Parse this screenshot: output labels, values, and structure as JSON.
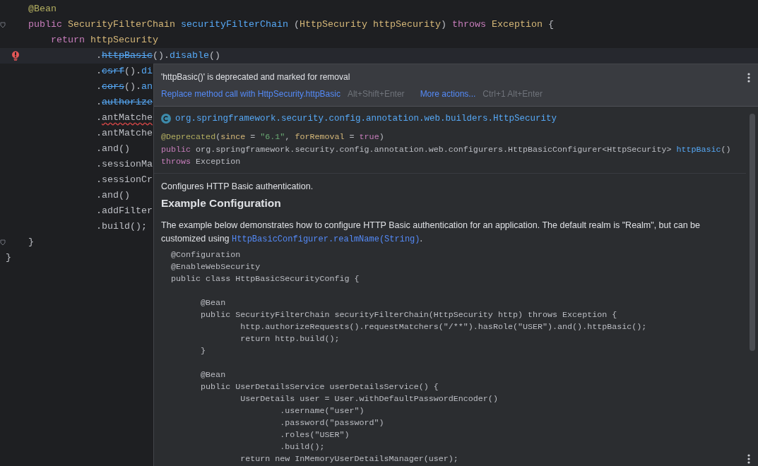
{
  "editor": {
    "lines": [
      {
        "current": false,
        "tokens": [
          {
            "text": "    @Bean",
            "kind": "annotation"
          }
        ]
      },
      {
        "current": false,
        "fold": true,
        "tokens": [
          {
            "text": "    public ",
            "kind": "keyword"
          },
          {
            "text": "SecurityFilterChain ",
            "kind": "type"
          },
          {
            "text": "securityFilterChain ",
            "kind": "method"
          },
          {
            "text": "(",
            "kind": "plain"
          },
          {
            "text": "HttpSecurity httpSecurity",
            "kind": "type"
          },
          {
            "text": ") ",
            "kind": "plain"
          },
          {
            "text": "throws ",
            "kind": "keyword"
          },
          {
            "text": "Exception ",
            "kind": "type"
          },
          {
            "text": "{",
            "kind": "plain"
          }
        ]
      },
      {
        "current": false,
        "tokens": [
          {
            "text": "        return ",
            "kind": "keyword"
          },
          {
            "text": "httpSecurity",
            "kind": "type"
          }
        ]
      },
      {
        "current": true,
        "error": true,
        "tokens": [
          {
            "text": "                .",
            "kind": "plain"
          },
          {
            "text": "httpBasic",
            "kind": "deprecated"
          },
          {
            "text": "().",
            "kind": "plain"
          },
          {
            "text": "disable",
            "kind": "method"
          },
          {
            "text": "()",
            "kind": "plain"
          }
        ]
      },
      {
        "current": false,
        "tokens": [
          {
            "text": "                .",
            "kind": "plain"
          },
          {
            "text": "csrf",
            "kind": "deprecated"
          },
          {
            "text": "().",
            "kind": "plain"
          },
          {
            "text": "di",
            "kind": "method"
          }
        ]
      },
      {
        "current": false,
        "tokens": [
          {
            "text": "                .",
            "kind": "plain"
          },
          {
            "text": "cors",
            "kind": "deprecated"
          },
          {
            "text": "().",
            "kind": "plain"
          },
          {
            "text": "an",
            "kind": "method"
          }
        ]
      },
      {
        "current": false,
        "tokens": [
          {
            "text": "                .",
            "kind": "plain"
          },
          {
            "text": "authorize",
            "kind": "deprecated"
          }
        ]
      },
      {
        "current": false,
        "tokens": [
          {
            "text": "                .",
            "kind": "plain"
          },
          {
            "text": "antMatche",
            "kind": "error"
          }
        ]
      },
      {
        "current": false,
        "tokens": [
          {
            "text": "                .antMatche",
            "kind": "plain"
          }
        ]
      },
      {
        "current": false,
        "tokens": [
          {
            "text": "                .and()",
            "kind": "plain"
          }
        ]
      },
      {
        "current": false,
        "tokens": [
          {
            "text": "                .sessionMa",
            "kind": "plain"
          }
        ]
      },
      {
        "current": false,
        "tokens": [
          {
            "text": "                .sessionCr",
            "kind": "plain"
          }
        ]
      },
      {
        "current": false,
        "tokens": [
          {
            "text": "                .and()",
            "kind": "plain"
          }
        ]
      },
      {
        "current": false,
        "tokens": [
          {
            "text": "                .addFilter",
            "kind": "plain"
          }
        ]
      },
      {
        "current": false,
        "tokens": [
          {
            "text": "                .build();",
            "kind": "plain"
          }
        ]
      },
      {
        "current": false,
        "fold": true,
        "tokens": [
          {
            "text": "    }",
            "kind": "plain"
          }
        ]
      },
      {
        "current": false,
        "tokens": [
          {
            "text": "}",
            "kind": "plain"
          }
        ]
      }
    ]
  },
  "quick_doc": {
    "problem": "'httpBasic()' is deprecated and marked for removal",
    "actions": [
      {
        "label": "Replace method call with HttpSecurity.httpBasic",
        "shortcut": "Alt+Shift+Enter"
      },
      {
        "label": "More actions...",
        "shortcut": "Ctrl+1 Alt+Enter"
      }
    ],
    "class_name": "org.springframework.security.config.annotation.web.builders.HttpSecurity",
    "signature": [
      {
        "tokens": [
          {
            "text": "@Deprecated",
            "kind": "annotation"
          },
          {
            "text": "(",
            "kind": "plain"
          },
          {
            "text": "since",
            "kind": "type"
          },
          {
            "text": " = ",
            "kind": "plain"
          },
          {
            "text": "\"6.1\"",
            "kind": "string"
          },
          {
            "text": ", ",
            "kind": "plain"
          },
          {
            "text": "forRemoval",
            "kind": "type"
          },
          {
            "text": " = ",
            "kind": "plain"
          },
          {
            "text": "true",
            "kind": "keyword"
          },
          {
            "text": ")",
            "kind": "plain"
          }
        ]
      },
      {
        "tokens": [
          {
            "text": "public ",
            "kind": "keyword"
          },
          {
            "text": "org.springframework.security.config.annotation.web.configurers.HttpBasicConfigurer<HttpSecurity> ",
            "kind": "plain"
          },
          {
            "text": "httpBasic",
            "kind": "method"
          },
          {
            "text": "()",
            "kind": "plain"
          }
        ]
      },
      {
        "tokens": [
          {
            "text": "throws ",
            "kind": "keyword"
          },
          {
            "text": "Exception",
            "kind": "plain"
          }
        ]
      }
    ],
    "summary": "Configures HTTP Basic authentication.",
    "heading": "Example Configuration",
    "paragraph": [
      {
        "text": "The example below demonstrates how to configure HTTP Basic authentication for an application. The default realm is \"Realm\", but can be customized using ",
        "kind": "text"
      },
      {
        "text": "HttpBasicConfigurer.realmName(String)",
        "kind": "link"
      },
      {
        "text": ".",
        "kind": "text"
      }
    ],
    "code_blocks": [
      [
        "@Configuration",
        "@EnableWebSecurity",
        "public class HttpBasicSecurityConfig {"
      ],
      [
        "      @Bean",
        "      public SecurityFilterChain securityFilterChain(HttpSecurity http) throws Exception {",
        "              http.authorizeRequests().requestMatchers(\"/**\").hasRole(\"USER\").and().httpBasic();",
        "              return http.build();",
        "      }"
      ],
      [
        "      @Bean",
        "      public UserDetailsService userDetailsService() {",
        "              UserDetails user = User.withDefaultPasswordEncoder()",
        "                      .username(\"user\")",
        "                      .password(\"password\")",
        "                      .roles(\"USER\")",
        "                      .build();",
        "              return new InMemoryUserDetailsManager(user);"
      ]
    ]
  }
}
